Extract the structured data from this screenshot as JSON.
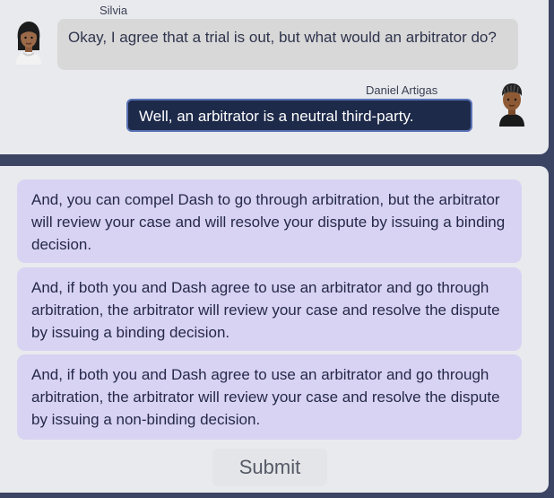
{
  "conversation": {
    "incoming": {
      "speaker": "Silvia",
      "text": "Okay, I agree that a trial is out, but what would an arbitrator do?"
    },
    "outgoing": {
      "speaker": "Daniel Artigas",
      "text": "Well, an arbitrator is a neutral third-party."
    }
  },
  "options": [
    "And, you can compel Dash to go through arbitration, but the arbitrator will review your case and will resolve your dispute by issuing a binding decision.",
    "And, if both you and Dash agree to use an arbitrator and go through arbitration, the arbitrator will review your case and resolve the dispute by issuing a binding decision.",
    "And, if both you and Dash agree to use an arbitrator and go through arbitration, the arbitrator will review your case and resolve the dispute by issuing a non-binding decision."
  ],
  "submit_label": "Submit",
  "colors": {
    "background": "#3b4463",
    "panel": "#e9eaee",
    "incoming_bubble": "#d8d8d8",
    "outgoing_bubble": "#1e2a4a",
    "option": "#d8d3f2"
  },
  "icons": [
    "silvia-avatar-icon",
    "daniel-avatar-icon"
  ]
}
